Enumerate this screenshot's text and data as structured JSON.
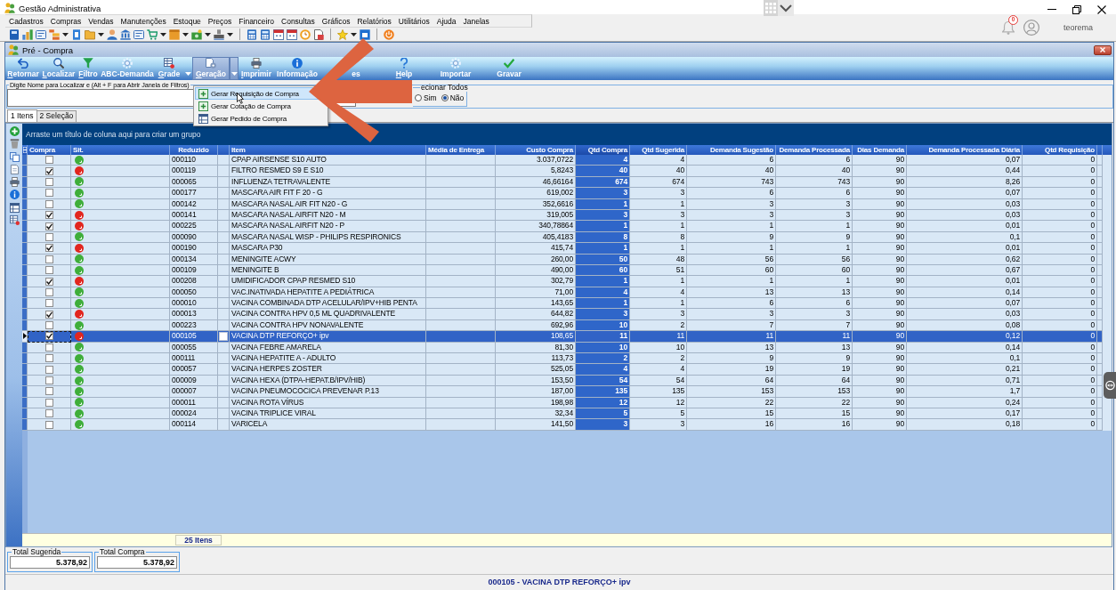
{
  "app_window": {
    "title": "Gestão Administrativa",
    "menu": [
      "Cadastros",
      "Compras",
      "Vendas",
      "Manutenções",
      "Estoque",
      "Preços",
      "Financeiro",
      "Consultas",
      "Gráficos",
      "Relatórios",
      "Utilitários",
      "Ajuda",
      "Janelas"
    ],
    "notifications": {
      "count": "0"
    },
    "user": {
      "name": "teorema"
    }
  },
  "document_window": {
    "title": "Pré - Compra",
    "toolbar": [
      {
        "label": "Retornar",
        "kind": "button",
        "accel": true,
        "pressed": false
      },
      {
        "label": "Localizar",
        "kind": "button",
        "accel": true,
        "pressed": false
      },
      {
        "label": "Filtro",
        "kind": "button",
        "accel": true,
        "pressed": false
      },
      {
        "label": "ABC-Demanda",
        "kind": "button",
        "accel": false,
        "pressed": false
      },
      {
        "label": "Grade",
        "kind": "split",
        "accel": true,
        "pressed": false
      },
      {
        "label": "Geração",
        "kind": "split",
        "accel": true,
        "pressed": true
      },
      {
        "label": "Imprimir",
        "kind": "button",
        "accel": true,
        "pressed": false
      },
      {
        "label": "Informação",
        "kind": "button",
        "accel": false,
        "pressed": false
      },
      {
        "label": "es",
        "kind": "button",
        "accel": false,
        "pressed": false
      },
      {
        "label": "Help",
        "kind": "button",
        "accel": true,
        "pressed": false
      },
      {
        "label": "Importar",
        "kind": "button",
        "accel": false,
        "pressed": false
      },
      {
        "label": "Gravar",
        "kind": "button",
        "accel": false,
        "pressed": false
      }
    ],
    "generation_menu": [
      {
        "label": "Gerar Requisição de Compra",
        "selected": true
      },
      {
        "label": "Gerar Cotação de Compra",
        "selected": false
      },
      {
        "label": "Gerar Pedido de Compra",
        "selected": false
      }
    ],
    "search": {
      "label": "Digite Nome para Localizar e (Alt + F para Abrir Janela de Filtros)"
    },
    "select_all": {
      "label": "ecionar Todos",
      "options": [
        {
          "label": "Sim",
          "selected": false
        },
        {
          "label": "Não",
          "selected": true
        }
      ]
    },
    "tabs": [
      {
        "label": "1 Itens",
        "selected": true
      },
      {
        "label": "2 Seleção",
        "selected": false
      }
    ],
    "table": {
      "group_hint": "Arraste um título de coluna aqui para criar um grupo",
      "columns": [
        {
          "label": "Compra",
          "highlighted": false
        },
        {
          "label": "Sit.",
          "highlighted": false
        },
        {
          "label": "Reduzido",
          "highlighted": false
        },
        {
          "label": "Item",
          "highlighted": false
        },
        {
          "label": "Média de Entrega",
          "highlighted": false
        },
        {
          "label": "Custo Compra",
          "highlighted": false
        },
        {
          "label": "Qtd Compra",
          "highlighted": true
        },
        {
          "label": "Qtd Sugerida",
          "highlighted": false
        },
        {
          "label": "Demanda Sugestão",
          "highlighted": false
        },
        {
          "label": "Demanda Processada",
          "highlighted": false
        },
        {
          "label": "Dias Demanda",
          "highlighted": false
        },
        {
          "label": "Demanda Processada Diária",
          "highlighted": false
        },
        {
          "label": "Qtd Requisição",
          "highlighted": false
        }
      ],
      "rows": [
        {
          "selected": false,
          "checked": false,
          "color": "#3fae3a",
          "reduzido": "000110",
          "item": "CPAP AIRSENSE S10 AUTO",
          "custo_compra": "3.037,0722",
          "qtd_compra": "4",
          "qtd_sugerida": "4",
          "demanda_sugestao": "6",
          "demanda_processada": "6",
          "dias_demanda": "90",
          "demanda_processada_diaria": "0,07",
          "qtd_requisicao": "0"
        },
        {
          "selected": false,
          "checked": true,
          "color": "#e2261f",
          "reduzido": "000119",
          "item": "FILTRO RESMED S9 E S10",
          "custo_compra": "5,8243",
          "qtd_compra": "40",
          "qtd_sugerida": "40",
          "demanda_sugestao": "40",
          "demanda_processada": "40",
          "dias_demanda": "90",
          "demanda_processada_diaria": "0,44",
          "qtd_requisicao": "0"
        },
        {
          "selected": false,
          "checked": false,
          "color": "#3fae3a",
          "reduzido": "000065",
          "item": "INFLUENZA TETRAVALENTE",
          "custo_compra": "46,66164",
          "qtd_compra": "674",
          "qtd_sugerida": "674",
          "demanda_sugestao": "743",
          "demanda_processada": "743",
          "dias_demanda": "90",
          "demanda_processada_diaria": "8,26",
          "qtd_requisicao": "0"
        },
        {
          "selected": false,
          "checked": false,
          "color": "#3fae3a",
          "reduzido": "000177",
          "item": "MASCARA AIR FIT F 20 - G",
          "custo_compra": "619,002",
          "qtd_compra": "3",
          "qtd_sugerida": "3",
          "demanda_sugestao": "6",
          "demanda_processada": "6",
          "dias_demanda": "90",
          "demanda_processada_diaria": "0,07",
          "qtd_requisicao": "0"
        },
        {
          "selected": false,
          "checked": false,
          "color": "#3fae3a",
          "reduzido": "000142",
          "item": "MASCARA NASAL AIR FIT N20 - G",
          "custo_compra": "352,6616",
          "qtd_compra": "1",
          "qtd_sugerida": "1",
          "demanda_sugestao": "3",
          "demanda_processada": "3",
          "dias_demanda": "90",
          "demanda_processada_diaria": "0,03",
          "qtd_requisicao": "0"
        },
        {
          "selected": false,
          "checked": true,
          "color": "#e2261f",
          "reduzido": "000141",
          "item": "MASCARA NASAL AIRFIT N20 - M",
          "custo_compra": "319,005",
          "qtd_compra": "3",
          "qtd_sugerida": "3",
          "demanda_sugestao": "3",
          "demanda_processada": "3",
          "dias_demanda": "90",
          "demanda_processada_diaria": "0,03",
          "qtd_requisicao": "0"
        },
        {
          "selected": false,
          "checked": true,
          "color": "#e2261f",
          "reduzido": "000225",
          "item": "MASCARA NASAL AIRFIT N20 - P",
          "custo_compra": "340,78864",
          "qtd_compra": "1",
          "qtd_sugerida": "1",
          "demanda_sugestao": "1",
          "demanda_processada": "1",
          "dias_demanda": "90",
          "demanda_processada_diaria": "0,01",
          "qtd_requisicao": "0"
        },
        {
          "selected": false,
          "checked": false,
          "color": "#3fae3a",
          "reduzido": "000090",
          "item": "MASCARA NASAL WISP - PHILIPS RESPIRONICS",
          "custo_compra": "405,4183",
          "qtd_compra": "8",
          "qtd_sugerida": "8",
          "demanda_sugestao": "9",
          "demanda_processada": "9",
          "dias_demanda": "90",
          "demanda_processada_diaria": "0,1",
          "qtd_requisicao": "0"
        },
        {
          "selected": false,
          "checked": true,
          "color": "#e2261f",
          "reduzido": "000190",
          "item": "MASCARA P30",
          "custo_compra": "415,74",
          "qtd_compra": "1",
          "qtd_sugerida": "1",
          "demanda_sugestao": "1",
          "demanda_processada": "1",
          "dias_demanda": "90",
          "demanda_processada_diaria": "0,01",
          "qtd_requisicao": "0"
        },
        {
          "selected": false,
          "checked": false,
          "color": "#3fae3a",
          "reduzido": "000134",
          "item": "MENINGITE ACWY",
          "custo_compra": "260,00",
          "qtd_compra": "50",
          "qtd_sugerida": "48",
          "demanda_sugestao": "56",
          "demanda_processada": "56",
          "dias_demanda": "90",
          "demanda_processada_diaria": "0,62",
          "qtd_requisicao": "0"
        },
        {
          "selected": false,
          "checked": false,
          "color": "#3fae3a",
          "reduzido": "000109",
          "item": "MENINGITE B",
          "custo_compra": "490,00",
          "qtd_compra": "60",
          "qtd_sugerida": "51",
          "demanda_sugestao": "60",
          "demanda_processada": "60",
          "dias_demanda": "90",
          "demanda_processada_diaria": "0,67",
          "qtd_requisicao": "0"
        },
        {
          "selected": false,
          "checked": true,
          "color": "#e2261f",
          "reduzido": "000208",
          "item": "UMIDIFICADOR CPAP RESMED S10",
          "custo_compra": "302,79",
          "qtd_compra": "1",
          "qtd_sugerida": "1",
          "demanda_sugestao": "1",
          "demanda_processada": "1",
          "dias_demanda": "90",
          "demanda_processada_diaria": "0,01",
          "qtd_requisicao": "0"
        },
        {
          "selected": false,
          "checked": false,
          "color": "#3fae3a",
          "reduzido": "000050",
          "item": "VAC.INATIVADA HEPATITE A PEDIÁTRICA",
          "custo_compra": "71,00",
          "qtd_compra": "4",
          "qtd_sugerida": "4",
          "demanda_sugestao": "13",
          "demanda_processada": "13",
          "dias_demanda": "90",
          "demanda_processada_diaria": "0,14",
          "qtd_requisicao": "0"
        },
        {
          "selected": false,
          "checked": false,
          "color": "#3fae3a",
          "reduzido": "000010",
          "item": "VACINA COMBINADA DTP ACELULAR/IPV+HIB PENTA",
          "custo_compra": "143,65",
          "qtd_compra": "1",
          "qtd_sugerida": "1",
          "demanda_sugestao": "6",
          "demanda_processada": "6",
          "dias_demanda": "90",
          "demanda_processada_diaria": "0,07",
          "qtd_requisicao": "0"
        },
        {
          "selected": false,
          "checked": true,
          "color": "#e2261f",
          "reduzido": "000013",
          "item": "VACINA CONTRA HPV 0,5 ML QUADRIVALENTE",
          "custo_compra": "644,82",
          "qtd_compra": "3",
          "qtd_sugerida": "3",
          "demanda_sugestao": "3",
          "demanda_processada": "3",
          "dias_demanda": "90",
          "demanda_processada_diaria": "0,03",
          "qtd_requisicao": "0"
        },
        {
          "selected": false,
          "checked": false,
          "color": "#3fae3a",
          "reduzido": "000223",
          "item": "VACINA CONTRA HPV NONAVALENTE",
          "custo_compra": "692,96",
          "qtd_compra": "10",
          "qtd_sugerida": "2",
          "demanda_sugestao": "7",
          "demanda_processada": "7",
          "dias_demanda": "90",
          "demanda_processada_diaria": "0,08",
          "qtd_requisicao": "0"
        },
        {
          "selected": true,
          "checked": true,
          "color": "#e2261f",
          "reduzido": "000105",
          "item": "VACINA DTP REFORÇO+ ipv",
          "custo_compra": "108,65",
          "qtd_compra": "11",
          "qtd_sugerida": "11",
          "demanda_sugestao": "11",
          "demanda_processada": "11",
          "dias_demanda": "90",
          "demanda_processada_diaria": "0,12",
          "qtd_requisicao": "0"
        },
        {
          "selected": false,
          "checked": false,
          "color": "#3fae3a",
          "reduzido": "000055",
          "item": "VACINA FEBRE AMARELA",
          "custo_compra": "81,30",
          "qtd_compra": "10",
          "qtd_sugerida": "10",
          "demanda_sugestao": "13",
          "demanda_processada": "13",
          "dias_demanda": "90",
          "demanda_processada_diaria": "0,14",
          "qtd_requisicao": "0"
        },
        {
          "selected": false,
          "checked": false,
          "color": "#3fae3a",
          "reduzido": "000111",
          "item": "VACINA HEPATITE A - ADULTO",
          "custo_compra": "113,73",
          "qtd_compra": "2",
          "qtd_sugerida": "2",
          "demanda_sugestao": "9",
          "demanda_processada": "9",
          "dias_demanda": "90",
          "demanda_processada_diaria": "0,1",
          "qtd_requisicao": "0"
        },
        {
          "selected": false,
          "checked": false,
          "color": "#3fae3a",
          "reduzido": "000057",
          "item": "VACINA HERPES ZOSTER",
          "custo_compra": "525,05",
          "qtd_compra": "4",
          "qtd_sugerida": "4",
          "demanda_sugestao": "19",
          "demanda_processada": "19",
          "dias_demanda": "90",
          "demanda_processada_diaria": "0,21",
          "qtd_requisicao": "0"
        },
        {
          "selected": false,
          "checked": false,
          "color": "#3fae3a",
          "reduzido": "000009",
          "item": "VACINA HEXA (DTPA-HEPAT.B/IPV/HIB)",
          "custo_compra": "153,50",
          "qtd_compra": "54",
          "qtd_sugerida": "54",
          "demanda_sugestao": "64",
          "demanda_processada": "64",
          "dias_demanda": "90",
          "demanda_processada_diaria": "0,71",
          "qtd_requisicao": "0"
        },
        {
          "selected": false,
          "checked": false,
          "color": "#3fae3a",
          "reduzido": "000007",
          "item": "VACINA PNEUMOCOCICA PREVENAR P.13",
          "custo_compra": "187,00",
          "qtd_compra": "135",
          "qtd_sugerida": "135",
          "demanda_sugestao": "153",
          "demanda_processada": "153",
          "dias_demanda": "90",
          "demanda_processada_diaria": "1,7",
          "qtd_requisicao": "0"
        },
        {
          "selected": false,
          "checked": false,
          "color": "#3fae3a",
          "reduzido": "000011",
          "item": "VACINA ROTA VÍRUS",
          "custo_compra": "198,98",
          "qtd_compra": "12",
          "qtd_sugerida": "12",
          "demanda_sugestao": "22",
          "demanda_processada": "22",
          "dias_demanda": "90",
          "demanda_processada_diaria": "0,24",
          "qtd_requisicao": "0"
        },
        {
          "selected": false,
          "checked": false,
          "color": "#3fae3a",
          "reduzido": "000024",
          "item": "VACINA TRIPLICE VIRAL",
          "custo_compra": "32,34",
          "qtd_compra": "5",
          "qtd_sugerida": "5",
          "demanda_sugestao": "15",
          "demanda_processada": "15",
          "dias_demanda": "90",
          "demanda_processada_diaria": "0,17",
          "qtd_requisicao": "0"
        },
        {
          "selected": false,
          "checked": false,
          "color": "#3fae3a",
          "reduzido": "000114",
          "item": "VARICELA",
          "custo_compra": "141,50",
          "qtd_compra": "3",
          "qtd_sugerida": "3",
          "demanda_sugestao": "16",
          "demanda_processada": "16",
          "dias_demanda": "90",
          "demanda_processada_diaria": "0,18",
          "qtd_requisicao": "0"
        }
      ],
      "footer_count": "25 Itens"
    },
    "totals": [
      {
        "label": "Total Sugerida",
        "value": "5.378,92"
      },
      {
        "label": "Total Compra",
        "value": "5.378,92"
      }
    ],
    "status_bar": {
      "text": "000105 - VACINA DTP REFORÇO+ ipv"
    }
  }
}
